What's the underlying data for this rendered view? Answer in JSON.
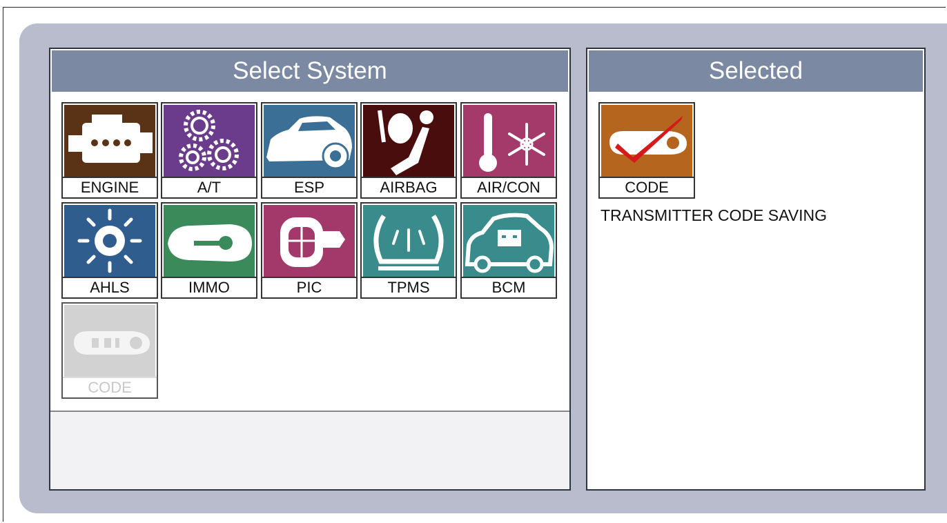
{
  "colors": {
    "engine": "#5a3216",
    "at": "#6b3c8c",
    "esp": "#3b6f96",
    "airbag": "#4a0d0d",
    "aircon": "#a33a6a",
    "ahls": "#2f5e8e",
    "immo": "#3a8a5a",
    "pic": "#a3386a",
    "tpms": "#3a8c8c",
    "bcm": "#3a8c8c",
    "code": "#b5651d",
    "code_disabled": "#d2d2d2"
  },
  "select_system": {
    "title": "Select System",
    "tiles": [
      {
        "label": "ENGINE",
        "icon": "engine-icon"
      },
      {
        "label": "A/T",
        "icon": "gears-icon"
      },
      {
        "label": "ESP",
        "icon": "car-brake-icon"
      },
      {
        "label": "AIRBAG",
        "icon": "airbag-icon"
      },
      {
        "label": "AIR/CON",
        "icon": "thermometer-snowflake-icon"
      },
      {
        "label": "AHLS",
        "icon": "headlight-sun-icon"
      },
      {
        "label": "IMMO",
        "icon": "key-icon"
      },
      {
        "label": "PIC",
        "icon": "smart-key-icon"
      },
      {
        "label": "TPMS",
        "icon": "tire-pressure-icon"
      },
      {
        "label": "BCM",
        "icon": "car-battery-icon"
      },
      {
        "label": "CODE",
        "icon": "remote-key-icon",
        "state": "disabled"
      }
    ]
  },
  "selected": {
    "title": "Selected",
    "tile": {
      "label": "CODE",
      "icon": "remote-key-check-icon"
    },
    "description": "TRANSMITTER CODE SAVING"
  }
}
